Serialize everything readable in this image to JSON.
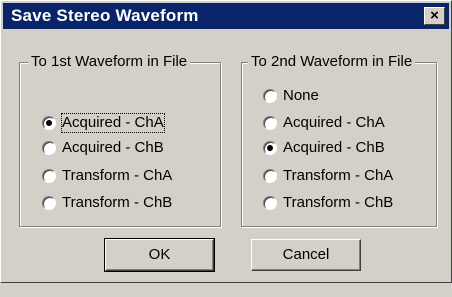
{
  "window": {
    "title": "Save Stereo Waveform",
    "close_symbol": "×",
    "close_icon": "close-icon"
  },
  "group1": {
    "title": "To 1st Waveform in File",
    "options": [
      {
        "label": "Acquired - ChA",
        "selected": true
      },
      {
        "label": "Acquired - ChB",
        "selected": false
      },
      {
        "label": "Transform - ChA",
        "selected": false
      },
      {
        "label": "Transform - ChB",
        "selected": false
      }
    ]
  },
  "group2": {
    "title": "To 2nd Waveform in File",
    "options": [
      {
        "label": "None",
        "selected": false
      },
      {
        "label": "Acquired - ChA",
        "selected": false
      },
      {
        "label": "Acquired - ChB",
        "selected": true
      },
      {
        "label": "Transform - ChA",
        "selected": false
      },
      {
        "label": "Transform - ChB",
        "selected": false
      }
    ]
  },
  "buttons": {
    "ok": "OK",
    "cancel": "Cancel"
  },
  "colors": {
    "titlebar": "#0a246a",
    "face": "#d4d0c8"
  }
}
